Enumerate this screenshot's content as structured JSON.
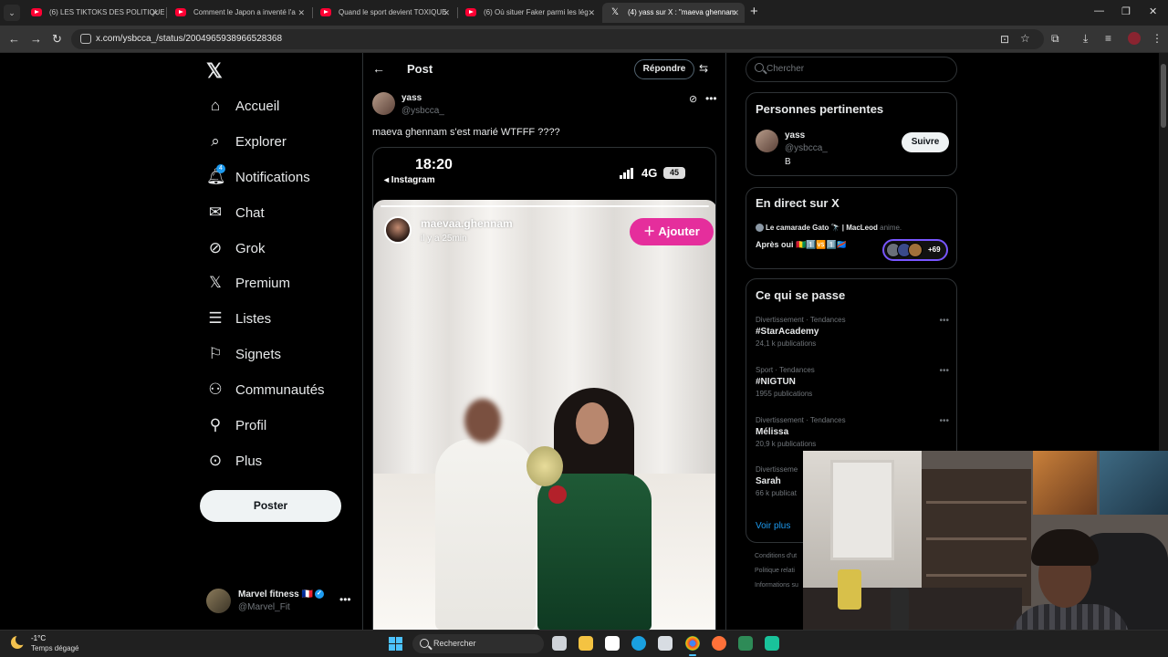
{
  "browser": {
    "tabs": [
      {
        "title": "(6) LES TIKTOKS DES POLITIQUES",
        "favicon": "youtube-icon",
        "active": false
      },
      {
        "title": "Comment le Japon a inventé l'a",
        "favicon": "youtube-icon",
        "active": false
      },
      {
        "title": "Quand le sport devient TOXIQUE",
        "favicon": "youtube-icon",
        "active": false
      },
      {
        "title": "(6) Où situer Faker parmi les lég",
        "favicon": "youtube-icon",
        "active": false
      },
      {
        "title": "(4) yass sur X : \"maeva ghennam",
        "favicon": "x-icon",
        "active": true
      }
    ],
    "url": "x.com/ysbcca_/status/2004965938966528368",
    "accent": "#4cc2ff"
  },
  "nav": {
    "items": [
      {
        "label": "Accueil",
        "icon": "home-icon"
      },
      {
        "label": "Explorer",
        "icon": "search-icon"
      },
      {
        "label": "Notifications",
        "icon": "bell-icon",
        "badge": "4"
      },
      {
        "label": "Chat",
        "icon": "mail-icon"
      },
      {
        "label": "Grok",
        "icon": "grok-icon"
      },
      {
        "label": "Premium",
        "icon": "x-icon"
      },
      {
        "label": "Listes",
        "icon": "list-icon"
      },
      {
        "label": "Signets",
        "icon": "bookmark-icon"
      },
      {
        "label": "Communautés",
        "icon": "communities-icon"
      },
      {
        "label": "Profil",
        "icon": "person-icon"
      },
      {
        "label": "Plus",
        "icon": "more-circle-icon"
      }
    ],
    "post_button": "Poster",
    "account": {
      "name": "Marvel fitness",
      "flag": "🇫🇷",
      "handle": "@Marvel_Fit"
    }
  },
  "main": {
    "header_title": "Post",
    "reply_label": "Répondre",
    "post": {
      "author_name": "yass",
      "author_handle": "@ysbcca_",
      "text": "maeva ghennam s'est marié WTFFF ????"
    },
    "media": {
      "phone_time": "18:20",
      "phone_app": "◂ Instagram",
      "network": "4G",
      "battery": "45",
      "story_user": "maevaa.ghennam",
      "story_time": "il y a 25min",
      "add_label": "Ajouter",
      "add_color": "#e52e9c"
    }
  },
  "sidebar": {
    "search_placeholder": "Chercher",
    "relevant": {
      "title": "Personnes pertinentes",
      "name": "yass",
      "handle": "@ysbcca_",
      "bio": "B",
      "follow_label": "Suivre"
    },
    "live": {
      "title": "En direct sur X",
      "host_line": "Le camarade Gato 🔭 | MacLeod",
      "host_suffix": "anime.",
      "subtitle": "Après oui 🇬🇳1️⃣🆚1️⃣🇨🇩",
      "listeners": "+69"
    },
    "trends": {
      "title": "Ce qui se passe",
      "items": [
        {
          "category": "Divertissement · Tendances",
          "name": "#StarAcademy",
          "count": "24,1 k publications"
        },
        {
          "category": "Sport · Tendances",
          "name": "#NIGTUN",
          "count": "1955 publications"
        },
        {
          "category": "Divertissement · Tendances",
          "name": "Mélissa",
          "count": "20,9 k publications"
        },
        {
          "category": "Divertisseme",
          "name": "Sarah",
          "count": "66 k publicat"
        }
      ],
      "see_more": "Voir plus"
    },
    "footer": [
      "Conditions d'ut",
      "Politique relati",
      "Informations su"
    ]
  },
  "taskbar": {
    "temperature": "-1°C",
    "weather": "Temps dégagé",
    "search_label": "Rechercher"
  }
}
